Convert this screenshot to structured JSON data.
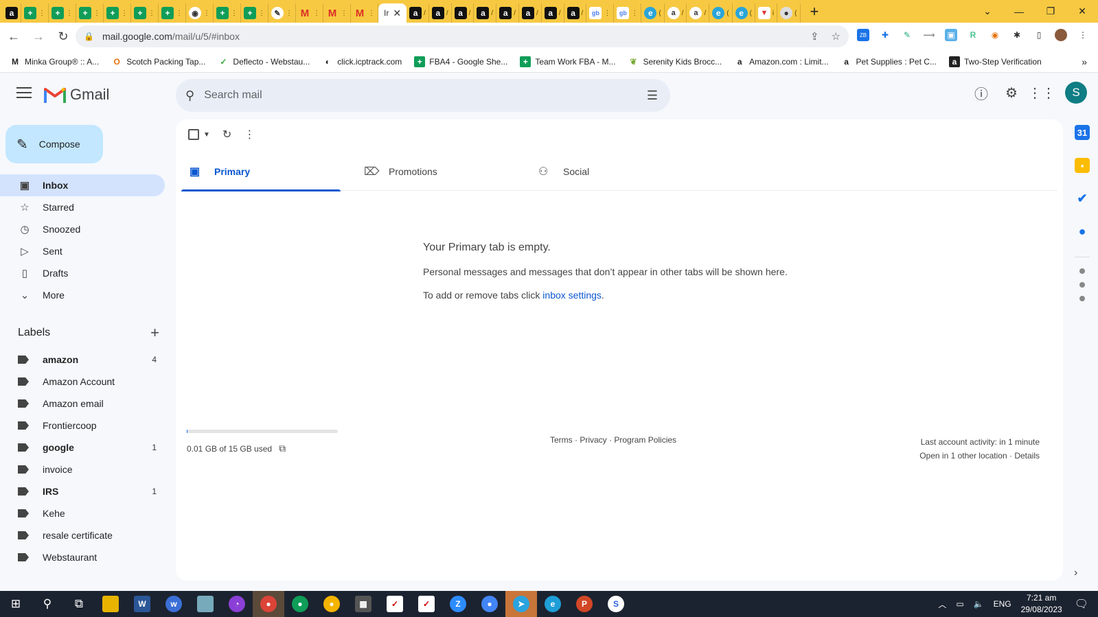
{
  "browser": {
    "active_tab_title": "Ir",
    "new_tab_symbol": "+",
    "url_host": "mail.google.com",
    "url_path": "/mail/u/5/#inbox",
    "bookmarks": [
      {
        "icon": "minka-icon",
        "label": "Minka Group® :: A..."
      },
      {
        "icon": "scotch-icon",
        "label": "Scotch Packing Tap..."
      },
      {
        "icon": "deflecto-icon",
        "label": "Deflecto - Webstau..."
      },
      {
        "icon": "globe-icon",
        "label": "click.icptrack.com"
      },
      {
        "icon": "sheets-icon",
        "label": "FBA4 - Google She..."
      },
      {
        "icon": "sheets-icon",
        "label": "Team Work FBA - M..."
      },
      {
        "icon": "leaf-icon",
        "label": "Serenity Kids Brocc..."
      },
      {
        "icon": "amazon-icon",
        "label": "Amazon.com : Limit..."
      },
      {
        "icon": "amazon-icon",
        "label": "Pet Supplies : Pet C..."
      },
      {
        "icon": "amazon-icon",
        "label": "Two-Step Verification"
      }
    ]
  },
  "gmail": {
    "app_name": "Gmail",
    "search_placeholder": "Search mail",
    "avatar_letter": "S",
    "compose_label": "Compose",
    "nav": [
      {
        "icon": "inbox-icon",
        "label": "Inbox",
        "active": true
      },
      {
        "icon": "star-icon",
        "label": "Starred"
      },
      {
        "icon": "clock-icon",
        "label": "Snoozed"
      },
      {
        "icon": "send-icon",
        "label": "Sent"
      },
      {
        "icon": "draft-icon",
        "label": "Drafts"
      },
      {
        "icon": "chevron-down-icon",
        "label": "More"
      }
    ],
    "labels_title": "Labels",
    "labels": [
      {
        "name": "amazon",
        "count": "4",
        "bold": true
      },
      {
        "name": "Amazon Account",
        "count": ""
      },
      {
        "name": "Amazon email",
        "count": ""
      },
      {
        "name": "Frontiercoop",
        "count": ""
      },
      {
        "name": "google",
        "count": "1",
        "bold": true
      },
      {
        "name": "invoice",
        "count": ""
      },
      {
        "name": "IRS",
        "count": "1",
        "bold": true
      },
      {
        "name": "Kehe",
        "count": ""
      },
      {
        "name": "resale certificate",
        "count": ""
      },
      {
        "name": "Webstaurant",
        "count": ""
      }
    ],
    "tabs": [
      {
        "icon": "inbox-tab-icon",
        "label": "Primary",
        "active": true
      },
      {
        "icon": "tag-icon",
        "label": "Promotions"
      },
      {
        "icon": "people-icon",
        "label": "Social"
      }
    ],
    "empty": {
      "heading": "Your Primary tab is empty.",
      "body": "Personal messages and messages that don’t appear in other tabs will be shown here.",
      "settings_prefix": "To add or remove tabs click ",
      "settings_link": "inbox settings",
      "settings_suffix": "."
    },
    "storage": {
      "used_text": "0.01 GB of 15 GB used",
      "used_fraction": 0.0007
    },
    "footer": {
      "terms": "Terms",
      "privacy": "Privacy",
      "policies": "Program Policies",
      "separator": " · ",
      "last_activity": "Last account activity: in 1 minute",
      "open_location": "Open in 1 other location",
      "details": "Details"
    }
  },
  "taskbar": {
    "language": "ENG",
    "time": "7:21 am",
    "date": "29/08/2023"
  },
  "colors": {
    "tabstrip": "#f7c942",
    "accent": "#0b57d0",
    "compose": "#c2e7ff",
    "active_nav": "#d3e3fd"
  }
}
